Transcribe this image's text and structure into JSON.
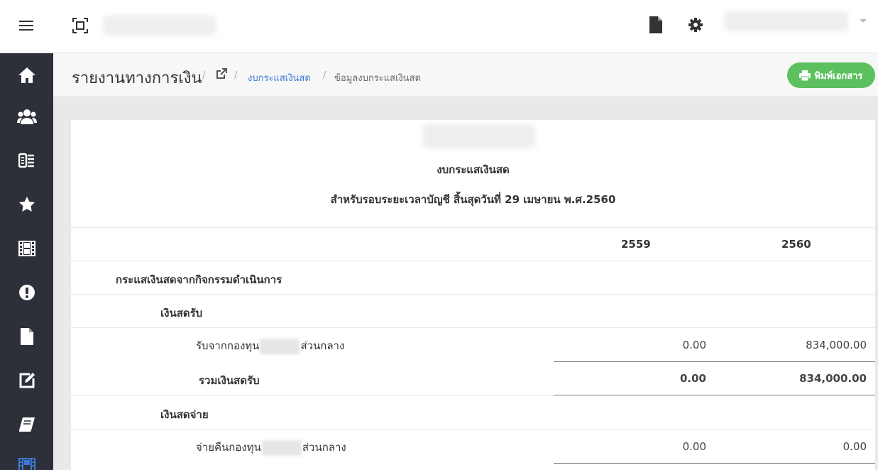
{
  "topbar": {
    "menu_icon": "hamburger-icon",
    "fullscreen_icon": "fullscreen-icon",
    "document_icon": "file-icon",
    "settings_icon": "gear-icon"
  },
  "sidebar": {
    "items": [
      {
        "icon": "home-icon"
      },
      {
        "icon": "users-icon"
      },
      {
        "icon": "ledger-icon"
      },
      {
        "icon": "star-icon"
      },
      {
        "icon": "film-icon"
      },
      {
        "icon": "alert-icon"
      },
      {
        "icon": "file-icon"
      },
      {
        "icon": "edit-icon"
      },
      {
        "icon": "book-icon"
      },
      {
        "icon": "film-icon",
        "active": true
      }
    ],
    "active_color": "#3a7bd5"
  },
  "breadcrumb": {
    "title": "รายงานทางการเงิน",
    "link": "งบกระแสเงินสด",
    "current": "ข้อมูลงบกระแสเงินสด",
    "separator": "/"
  },
  "actions": {
    "print_label": "พิมพ์เอกสาร",
    "print_color": "#5cc05f"
  },
  "report": {
    "title": "งบกระแสเงินสด",
    "subtitle": "สำหรับรอบระยะเวลาบัญชี สิ้นสุดวันที่ 29 เมษายน พ.ศ.2560",
    "years": [
      "2559",
      "2560"
    ],
    "section": "กระแสเงินสดจากกิจกรรมดำเนินการ",
    "receipts": {
      "heading": "เงินสดรับ",
      "row_prefix": "รับจากกองทุน",
      "row_suffix": "ส่วนกลาง",
      "row_2559": "0.00",
      "row_2560": "834,000.00",
      "total_label": "รวมเงินสดรับ",
      "total_2559": "0.00",
      "total_2560": "834,000.00"
    },
    "payments": {
      "heading": "เงินสดจ่าย",
      "row_prefix": "จ่ายคืนกองทุน",
      "row_suffix": "ส่วนกลาง",
      "row_2559": "0.00",
      "row_2560": "0.00"
    }
  }
}
